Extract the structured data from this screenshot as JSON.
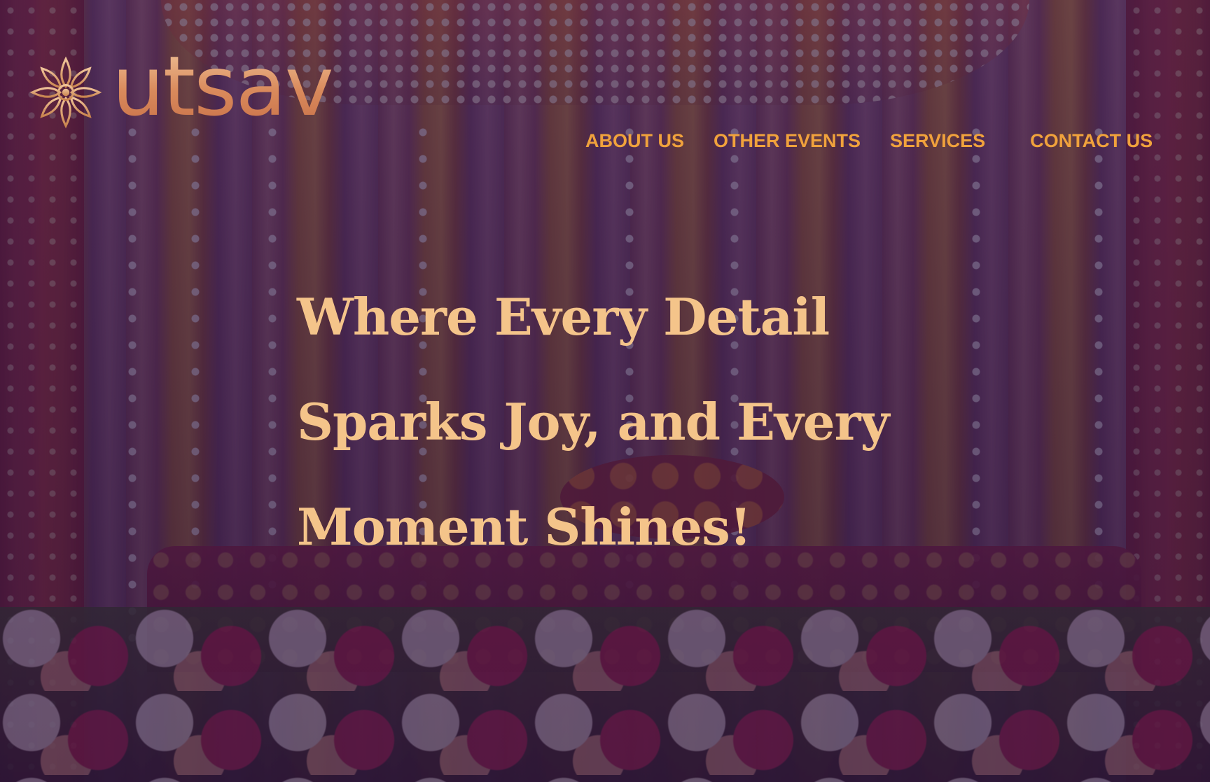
{
  "brand": {
    "name": "utsav",
    "icon": "lotus-icon",
    "color": "#e4a070"
  },
  "nav": {
    "items": [
      {
        "label": "ABOUT US"
      },
      {
        "label": "OTHER EVENTS"
      },
      {
        "label": "SERVICES"
      },
      {
        "label": "CONTACT US"
      }
    ],
    "color": "#f0a23c"
  },
  "hero": {
    "lines": [
      "Where Every Detail",
      "Sparks Joy, and Every",
      "Moment Shines!"
    ],
    "color": "#f4c48a"
  },
  "background": {
    "description_icon": "wedding-stage-background-image"
  }
}
